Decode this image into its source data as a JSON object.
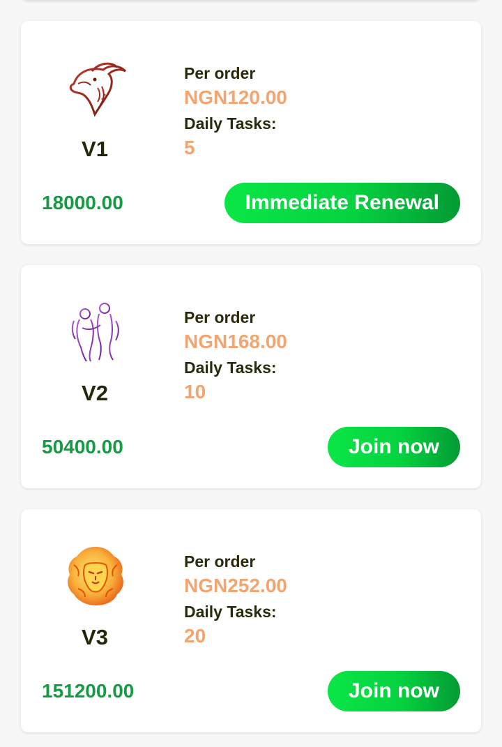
{
  "plans": [
    {
      "level": "V1",
      "per_order_label": "Per order",
      "per_order_value": "NGN120.00",
      "daily_tasks_label": "Daily Tasks:",
      "daily_tasks_value": "5",
      "price": "18000.00",
      "action_label": "Immediate Renewal",
      "emblem_icon": "goat-emblem-icon"
    },
    {
      "level": "V2",
      "per_order_label": "Per order",
      "per_order_value": "NGN168.00",
      "daily_tasks_label": "Daily Tasks:",
      "daily_tasks_value": "10",
      "price": "50400.00",
      "action_label": "Join now",
      "emblem_icon": "twins-emblem-icon"
    },
    {
      "level": "V3",
      "per_order_label": "Per order",
      "per_order_value": "NGN252.00",
      "daily_tasks_label": "Daily Tasks:",
      "daily_tasks_value": "20",
      "price": "151200.00",
      "action_label": "Join now",
      "emblem_icon": "lion-emblem-icon"
    }
  ],
  "colors": {
    "price_green": "#149c44",
    "value_orange": "#f2a571",
    "button_green": "#05d23f",
    "label_dark": "#2a2a0c"
  }
}
